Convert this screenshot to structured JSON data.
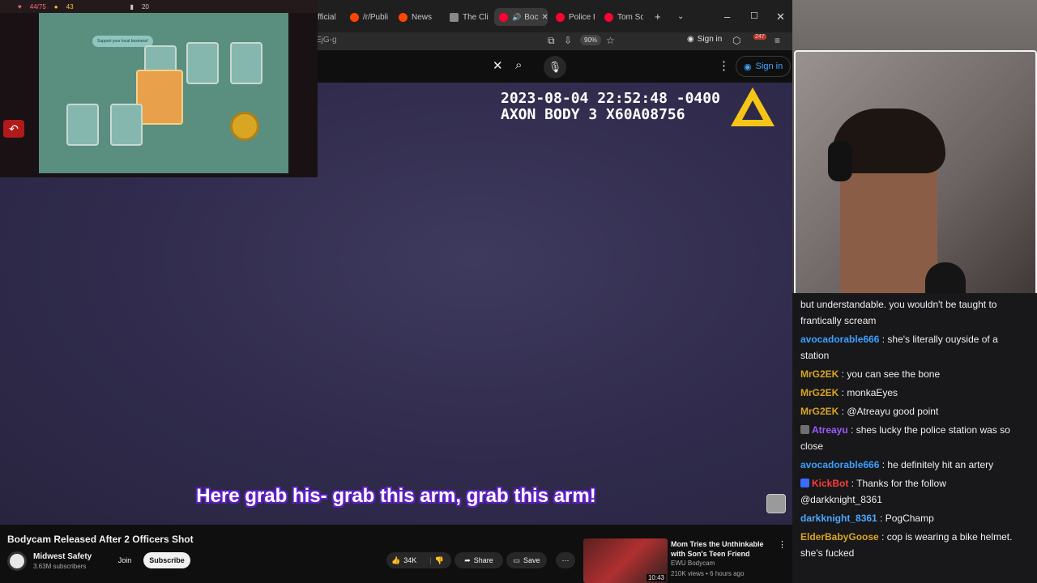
{
  "browser": {
    "tabs": [
      {
        "label": "fficial",
        "color": "#c4302b"
      },
      {
        "label": "/r/Publi",
        "color": "#ff4500"
      },
      {
        "label": "News",
        "color": "#ff4500"
      },
      {
        "label": "The Clin",
        "color": "#888888"
      },
      {
        "label": "Boc",
        "color": "#ff0033"
      },
      {
        "label": "Police D",
        "color": "#ff0033"
      },
      {
        "label": "Tom Scr",
        "color": "#ff0033"
      }
    ],
    "url_fragment": "EjG-g",
    "zoom": "90%",
    "sign_in": "Sign in",
    "notifications": "247"
  },
  "youtube": {
    "sign_in": "Sign in",
    "video": {
      "timestamp_line1": "2023-08-04 22:52:48 -0400",
      "timestamp_line2": "AXON BODY 3 X60A08756",
      "caption": "Here grab his- grab this arm, grab this arm!"
    },
    "title": "Bodycam Released After 2 Officers Shot",
    "channel": {
      "name": "Midwest Safety",
      "subscribers": "3.63M subscribers"
    },
    "join": "Join",
    "subscribe": "Subscribe",
    "likes": "34K",
    "share": "Share",
    "save": "Save",
    "recommended": {
      "title": "Mom Tries the Unthinkable with Son's Teen Friend",
      "channel": "EWU Bodycam",
      "meta": "210K views • 6 hours ago",
      "duration": "10:43"
    }
  },
  "game": {
    "hp": "44/75",
    "gold": "43",
    "stat": "20",
    "bubble": "Support your local business!"
  },
  "chat": {
    "messages": [
      {
        "user": "",
        "color": "#efeff1",
        "text": "but understandable. you wouldn't be taught to frantically scream",
        "badge": ""
      },
      {
        "user": "avocadorable666",
        "color": "#3aa0ff",
        "text": "she's literally ouyside of a station",
        "badge": ""
      },
      {
        "user": "MrG2EK",
        "color": "#daa520",
        "text": "you can see the bone",
        "badge": ""
      },
      {
        "user": "MrG2EK",
        "color": "#daa520",
        "text": "monkaEyes",
        "badge": ""
      },
      {
        "user": "MrG2EK",
        "color": "#daa520",
        "text": "@Atreayu good point",
        "badge": ""
      },
      {
        "user": "Atreayu",
        "color": "#9c5bff",
        "text": "shes lucky the police station was so close",
        "badge": "#6f6f6f"
      },
      {
        "user": "avocadorable666",
        "color": "#3aa0ff",
        "text": "he definitely hit an artery",
        "badge": ""
      },
      {
        "user": "KickBot",
        "color": "#ff3b3b",
        "text": "Thanks for the follow @darkknight_8361",
        "badge": "#3a6dff"
      },
      {
        "user": "darkknight_8361",
        "color": "#4aa8ff",
        "text": "PogChamp",
        "badge": ""
      },
      {
        "user": "ElderBabyGoose",
        "color": "#daa520",
        "text": "cop is wearing a bike helmet. she's fucked",
        "badge": ""
      }
    ]
  }
}
